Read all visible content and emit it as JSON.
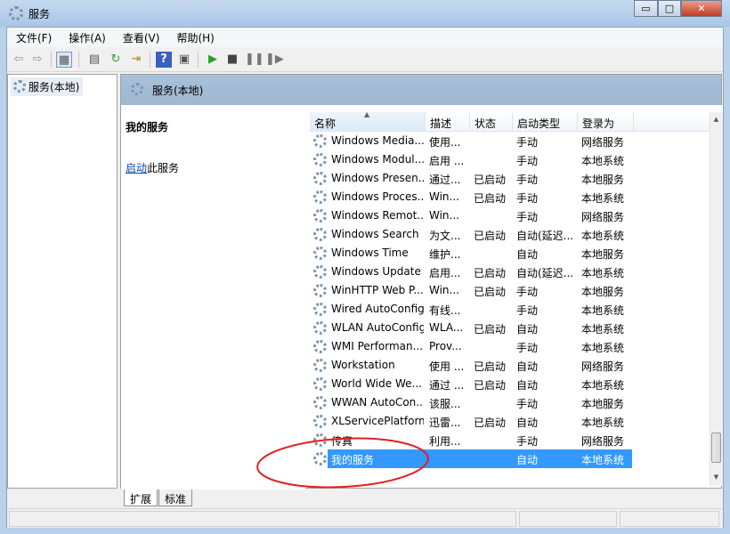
{
  "window": {
    "title": "服务",
    "minimize": "▭",
    "maximize": "□",
    "close": "✕"
  },
  "menu": [
    "文件(F)",
    "操作(A)",
    "查看(V)",
    "帮助(H)"
  ],
  "toolbar": [
    "back-icon",
    "forward-icon",
    "show-hide-tree-icon",
    "properties-icon",
    "refresh-icon",
    "export-list-icon",
    "help-icon",
    "show-action-pane-icon",
    "start-service-icon",
    "stop-service-icon",
    "pause-service-icon",
    "resume-service-icon"
  ],
  "tree": {
    "item": "服务(本地)"
  },
  "panel": {
    "title": "服务(本地)",
    "selected_name": "我的服务",
    "action_link": "启动",
    "action_suffix": "此服务"
  },
  "columns": [
    "名称",
    "描述",
    "状态",
    "启动类型",
    "登录为"
  ],
  "rows": [
    [
      "Windows Media...",
      "使用...",
      "",
      "手动",
      "网络服务"
    ],
    [
      "Windows Modul...",
      "启用 ...",
      "",
      "手动",
      "本地系统"
    ],
    [
      "Windows Presen...",
      "通过...",
      "已启动",
      "手动",
      "本地服务"
    ],
    [
      "Windows Proces...",
      "Win...",
      "已启动",
      "手动",
      "本地系统"
    ],
    [
      "Windows Remot...",
      "Win...",
      "",
      "手动",
      "网络服务"
    ],
    [
      "Windows Search",
      "为文...",
      "已启动",
      "自动(延迟...",
      "本地系统"
    ],
    [
      "Windows Time",
      "维护...",
      "",
      "自动",
      "本地服务"
    ],
    [
      "Windows Update",
      "启用...",
      "已启动",
      "自动(延迟...",
      "本地系统"
    ],
    [
      "WinHTTP Web P...",
      "Win...",
      "已启动",
      "手动",
      "本地服务"
    ],
    [
      "Wired AutoConfig",
      "有线...",
      "",
      "手动",
      "本地系统"
    ],
    [
      "WLAN AutoConfig",
      "WLA...",
      "已启动",
      "自动",
      "本地系统"
    ],
    [
      "WMI Performan...",
      "Prov...",
      "",
      "手动",
      "本地系统"
    ],
    [
      "Workstation",
      "使用 ...",
      "已启动",
      "自动",
      "网络服务"
    ],
    [
      "World Wide We...",
      "通过 ...",
      "已启动",
      "自动",
      "本地系统"
    ],
    [
      "WWAN AutoCon...",
      "该服...",
      "",
      "手动",
      "本地服务"
    ],
    [
      "XLServicePlatform",
      "迅雷...",
      "已启动",
      "自动",
      "本地系统"
    ],
    [
      "传真",
      "利用...",
      "",
      "手动",
      "网络服务"
    ],
    [
      "我的服务",
      "",
      "",
      "自动",
      "本地系统"
    ]
  ],
  "selected_row": 17,
  "tabs": [
    "扩展",
    "标准"
  ],
  "colors": {
    "selection": "#3399ff",
    "header_band": "#a9c0d9",
    "annotation": "#e02020"
  }
}
